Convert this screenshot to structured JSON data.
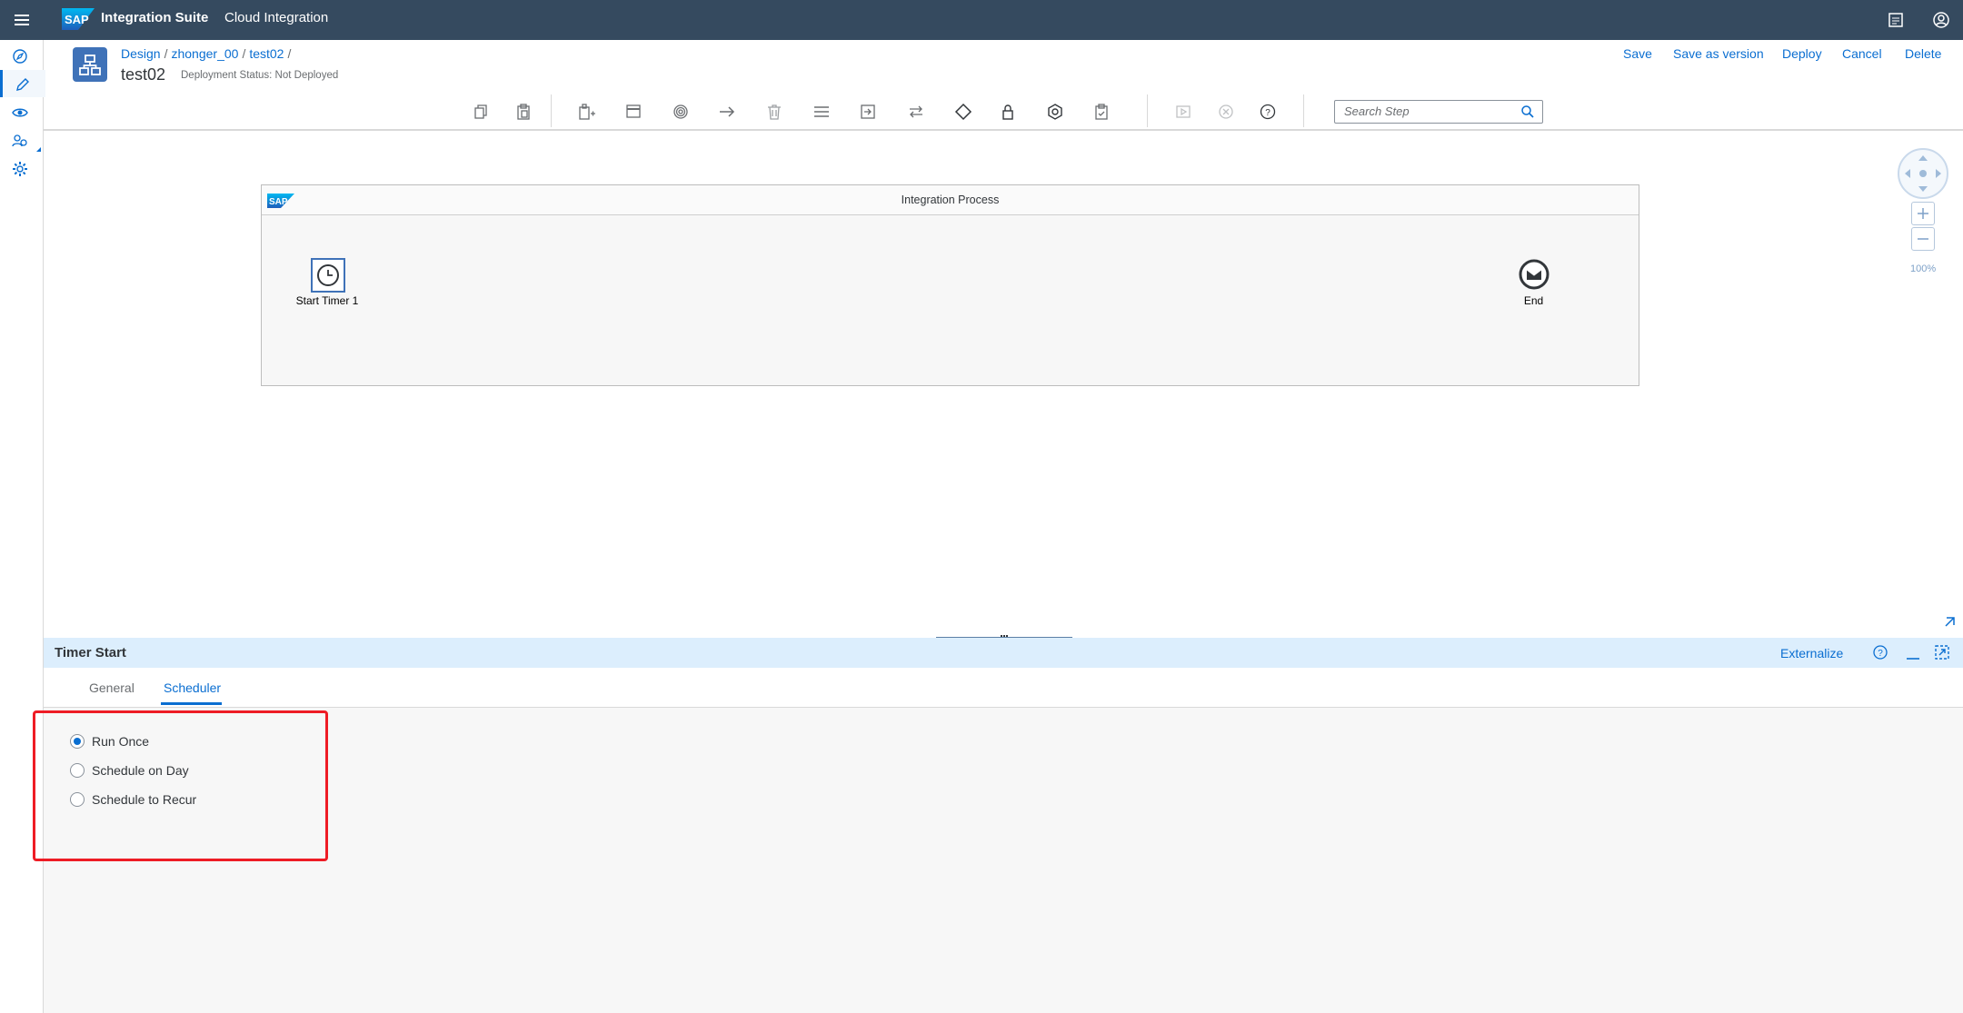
{
  "shell": {
    "logo_text": "SAP",
    "product": "Integration Suite",
    "subtitle": "Cloud Integration"
  },
  "leftnav": {
    "items": [
      {
        "name": "discover-icon"
      },
      {
        "name": "design-icon",
        "active": true
      },
      {
        "name": "monitor-icon"
      },
      {
        "name": "settings-users-icon"
      },
      {
        "name": "settings-icon"
      }
    ]
  },
  "header": {
    "breadcrumb": [
      "Design",
      "zhonger_00",
      "test02"
    ],
    "title": "test02",
    "deployment_status": "Deployment Status: Not Deployed",
    "actions": {
      "save": "Save",
      "save_as_version": "Save as version",
      "deploy": "Deploy",
      "cancel": "Cancel",
      "delete": "Delete"
    }
  },
  "toolbar": {
    "search_placeholder": "Search Step",
    "tools": [
      "copy-icon",
      "paste-icon",
      "participants-icon",
      "process-icon",
      "events-icon",
      "connector-icon",
      "delete-icon",
      "menu-icon",
      "call-icon",
      "transform-icon",
      "routing-icon",
      "security-icon",
      "persistence-icon",
      "validate-icon",
      "simulate-icon",
      "cancel-simulation-icon",
      "help-icon"
    ]
  },
  "canvas": {
    "zoom_level": "100%",
    "pool_logo": "SAP",
    "pool_name": "Integration Process",
    "start_event_label": "Start Timer 1",
    "end_event_label": "End"
  },
  "properties": {
    "title": "Timer Start",
    "externalize": "Externalize",
    "tabs": [
      "General",
      "Scheduler"
    ],
    "selected_tab": "Scheduler",
    "scheduler_options": [
      {
        "label": "Run Once",
        "selected": true
      },
      {
        "label": "Schedule on Day",
        "selected": false
      },
      {
        "label": "Schedule to Recur",
        "selected": false
      }
    ]
  },
  "colors": {
    "shell_bg": "#354a5f",
    "accent": "#0a6ed1",
    "highlight": "#ee1c25"
  }
}
